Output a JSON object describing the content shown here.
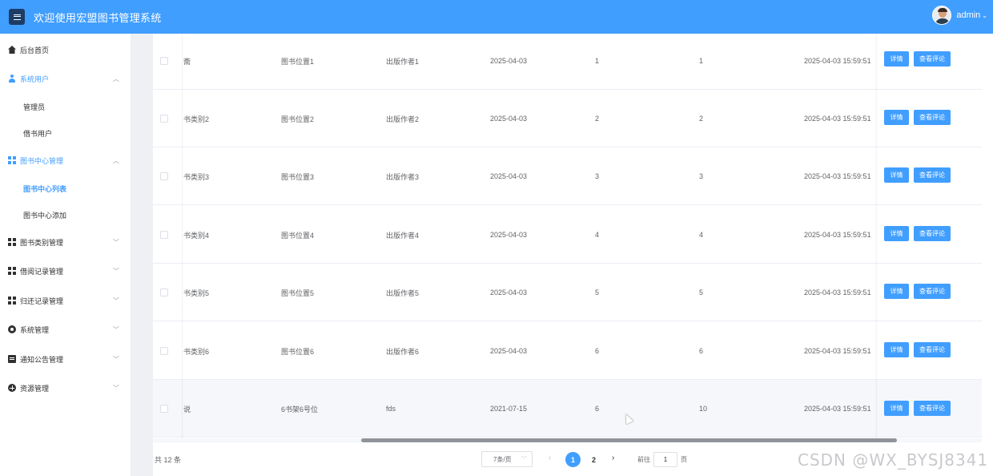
{
  "header": {
    "title": "欢迎使用宏盟图书管理系统",
    "user_name": "admin",
    "user_caret": "⌄"
  },
  "sidebar": {
    "items": [
      {
        "label": "后台首页",
        "icon": "home-icon"
      },
      {
        "label": "系统用户",
        "icon": "user-icon",
        "expanded": true
      },
      {
        "label": "管理员",
        "sub": true
      },
      {
        "label": "借书用户",
        "sub": true
      },
      {
        "label": "图书中心管理",
        "icon": "grid-icon",
        "expanded": true
      },
      {
        "label": "图书中心列表",
        "sub": true,
        "active": true
      },
      {
        "label": "图书中心添加",
        "sub": true
      },
      {
        "label": "图书类别管理",
        "icon": "grid-icon"
      },
      {
        "label": "借阅记录管理",
        "icon": "grid-icon"
      },
      {
        "label": "归还记录管理",
        "icon": "grid-icon"
      },
      {
        "label": "系统管理",
        "icon": "gear-icon"
      },
      {
        "label": "通知公告管理",
        "icon": "document-icon"
      },
      {
        "label": "资源管理",
        "icon": "plus-circle-icon"
      }
    ],
    "chevron_up": "︿",
    "chevron_down": "﹀"
  },
  "table": {
    "rows": [
      {
        "category": "斋",
        "location": "图书位置1",
        "author": "出版作者1",
        "date": "2025-04-03",
        "col5": "1",
        "col6": "1",
        "time": "2025-04-03 15:59:51"
      },
      {
        "category": "书类别2",
        "location": "图书位置2",
        "author": "出版作者2",
        "date": "2025-04-03",
        "col5": "2",
        "col6": "2",
        "time": "2025-04-03 15:59:51"
      },
      {
        "category": "书类别3",
        "location": "图书位置3",
        "author": "出版作者3",
        "date": "2025-04-03",
        "col5": "3",
        "col6": "3",
        "time": "2025-04-03 15:59:51"
      },
      {
        "category": "书类别4",
        "location": "图书位置4",
        "author": "出版作者4",
        "date": "2025-04-03",
        "col5": "4",
        "col6": "4",
        "time": "2025-04-03 15:59:51"
      },
      {
        "category": "书类别5",
        "location": "图书位置5",
        "author": "出版作者5",
        "date": "2025-04-03",
        "col5": "5",
        "col6": "5",
        "time": "2025-04-03 15:59:51"
      },
      {
        "category": "书类别6",
        "location": "图书位置6",
        "author": "出版作者6",
        "date": "2025-04-03",
        "col5": "6",
        "col6": "6",
        "time": "2025-04-03 15:59:51"
      },
      {
        "category": "说",
        "location": "6书架6号位",
        "author": "fds",
        "date": "2021-07-15",
        "col5": "6",
        "col6": "10",
        "time": "2025-04-03 15:59:51"
      }
    ],
    "detail_label": "详情",
    "review_label": "查看评论"
  },
  "pagination": {
    "total": "共 12 条",
    "page_size": "7条/页",
    "pages": [
      "1",
      "2"
    ],
    "current_page": 1,
    "prev": "‹",
    "next": "›",
    "goto_prefix": "前往",
    "goto_value": "1",
    "goto_suffix": "页"
  },
  "watermark": "CSDN @WX_BYSJ8341",
  "colors": {
    "primary": "#409eff",
    "sidebar_bg": "#ffffff",
    "text": "#606266"
  }
}
